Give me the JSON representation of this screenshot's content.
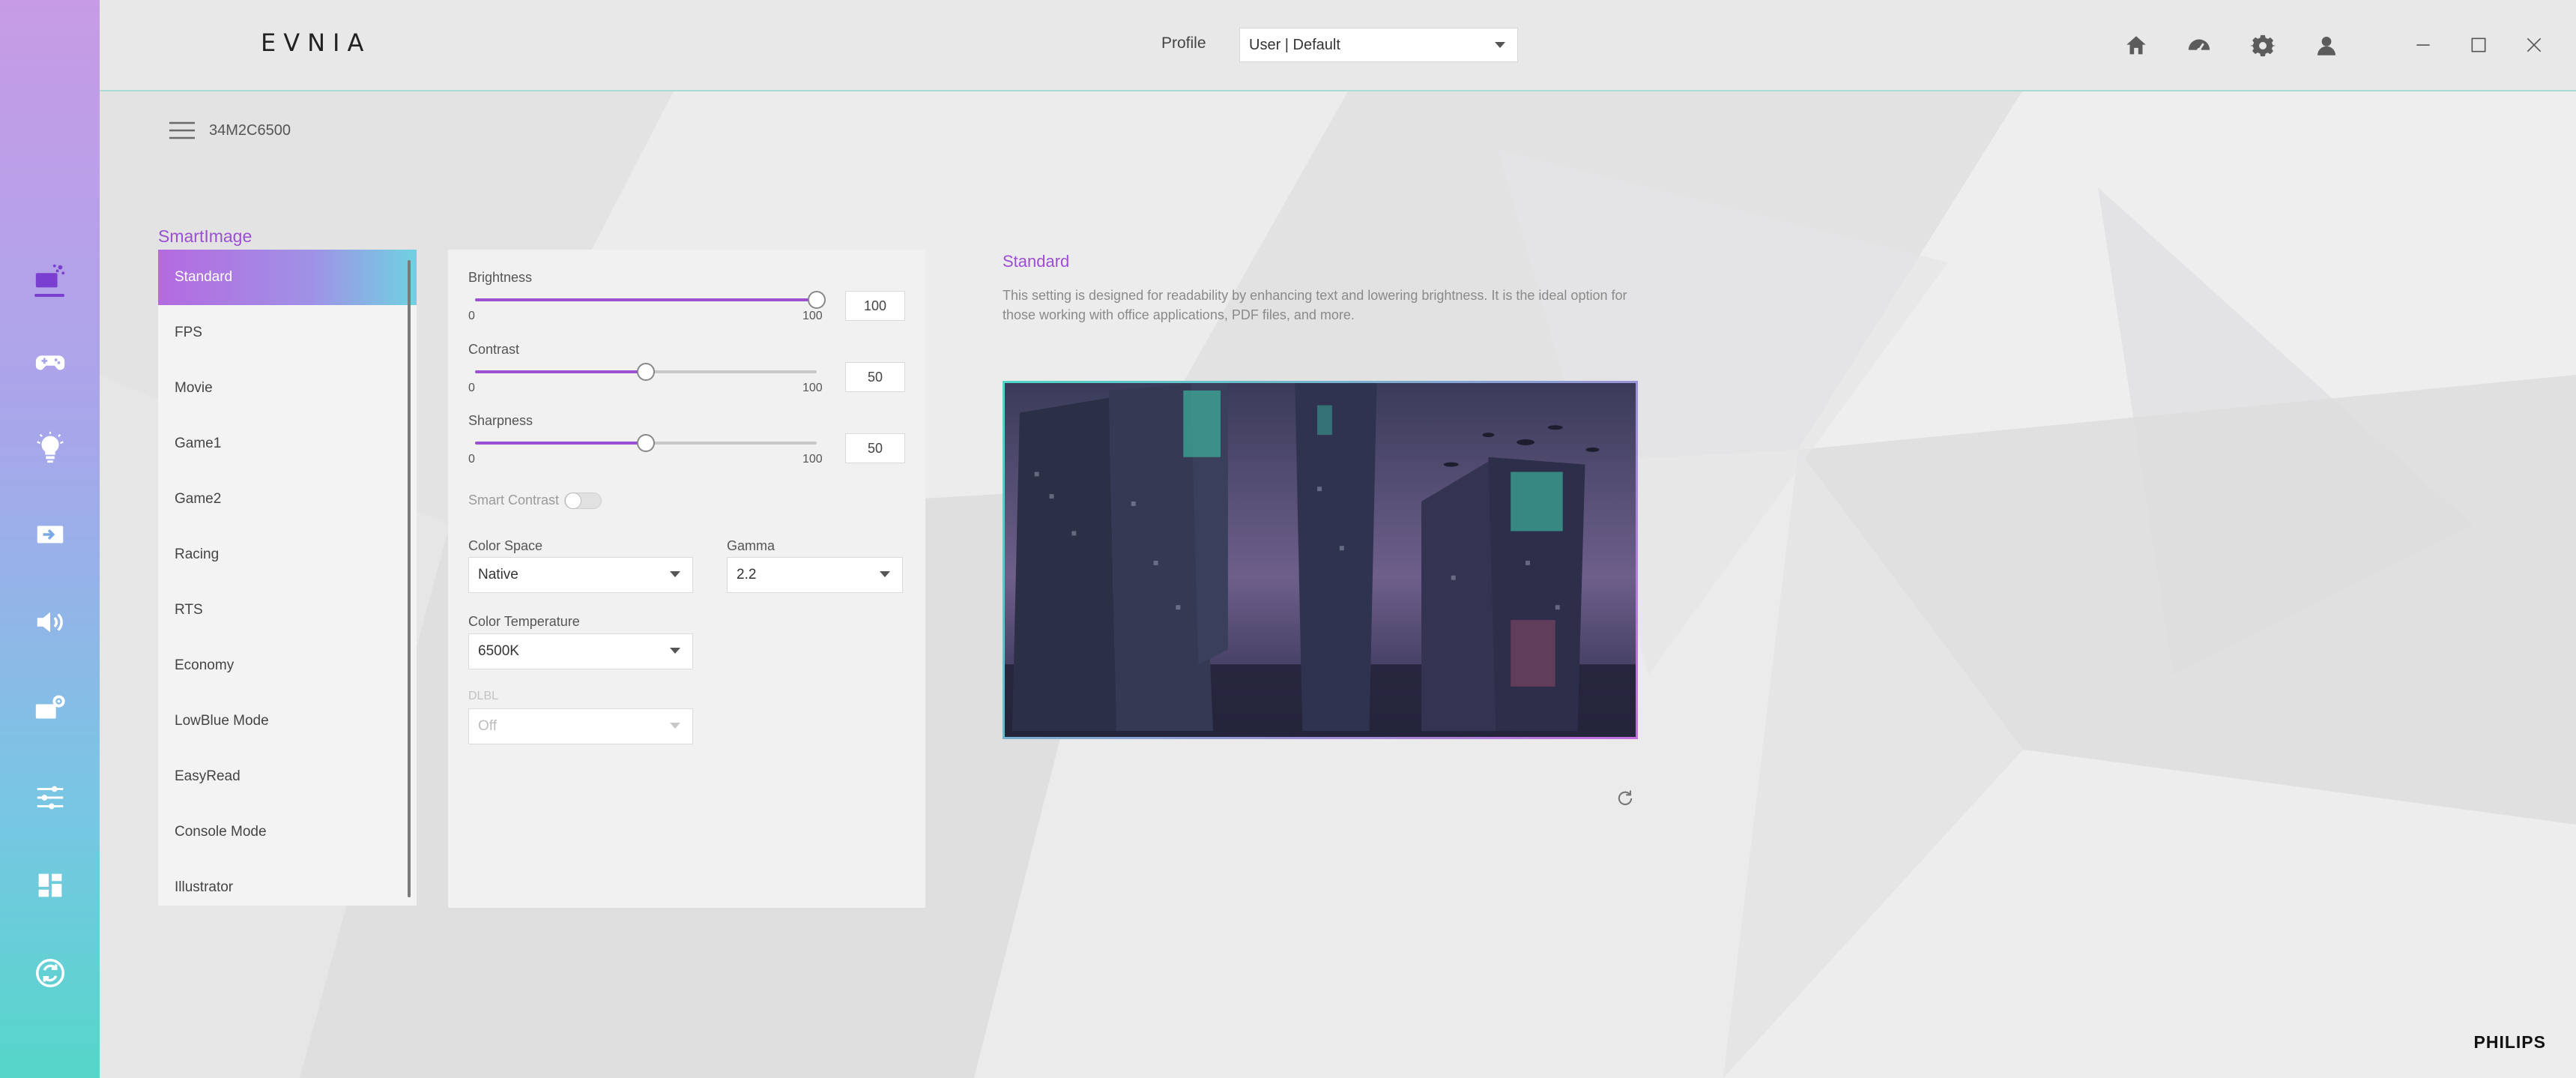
{
  "app": {
    "logo": "EVNIA",
    "brand": "PHILIPS"
  },
  "header": {
    "profile_label": "Profile",
    "profile_value": "User | Default",
    "icons": [
      "home-icon",
      "dashboard-icon",
      "settings-icon",
      "user-icon"
    ],
    "window_controls": [
      "minimize-icon",
      "maximize-icon",
      "close-icon"
    ]
  },
  "device": {
    "name": "34M2C6500"
  },
  "sidebar": {
    "items": [
      {
        "icon": "smartimage-icon",
        "active": true
      },
      {
        "icon": "gamepad-icon"
      },
      {
        "icon": "light-bulb-icon"
      },
      {
        "icon": "input-icon"
      },
      {
        "icon": "speaker-icon"
      },
      {
        "icon": "monitor-settings-icon"
      },
      {
        "icon": "sliders-icon"
      },
      {
        "icon": "layout-grid-icon"
      },
      {
        "icon": "sync-icon"
      }
    ]
  },
  "smartimage": {
    "title": "SmartImage",
    "modes": [
      "Standard",
      "FPS",
      "Movie",
      "Game1",
      "Game2",
      "Racing",
      "RTS",
      "Economy",
      "LowBlue Mode",
      "EasyRead",
      "Console Mode",
      "Illustrator"
    ],
    "selected": "Standard"
  },
  "controls": {
    "brightness": {
      "label": "Brightness",
      "min": "0",
      "max": "100",
      "value": "100"
    },
    "contrast": {
      "label": "Contrast",
      "min": "0",
      "max": "100",
      "value": "50"
    },
    "sharpness": {
      "label": "Sharpness",
      "min": "0",
      "max": "100",
      "value": "50"
    },
    "smart_contrast": {
      "label": "Smart Contrast",
      "enabled": false
    },
    "color_space": {
      "label": "Color Space",
      "value": "Native"
    },
    "gamma": {
      "label": "Gamma",
      "value": "2.2"
    },
    "color_temperature": {
      "label": "Color Temperature",
      "value": "6500K"
    },
    "dlbl": {
      "label": "DLBL",
      "value": "Off",
      "disabled": true
    }
  },
  "info": {
    "title": "Standard",
    "description": "This setting is designed for readability by enhancing text and lowering brightness. It is the ideal option for those working with office applications, PDF files, and more."
  },
  "colors": {
    "accent": "#9b4fd1",
    "teal": "#4fd6c5"
  }
}
